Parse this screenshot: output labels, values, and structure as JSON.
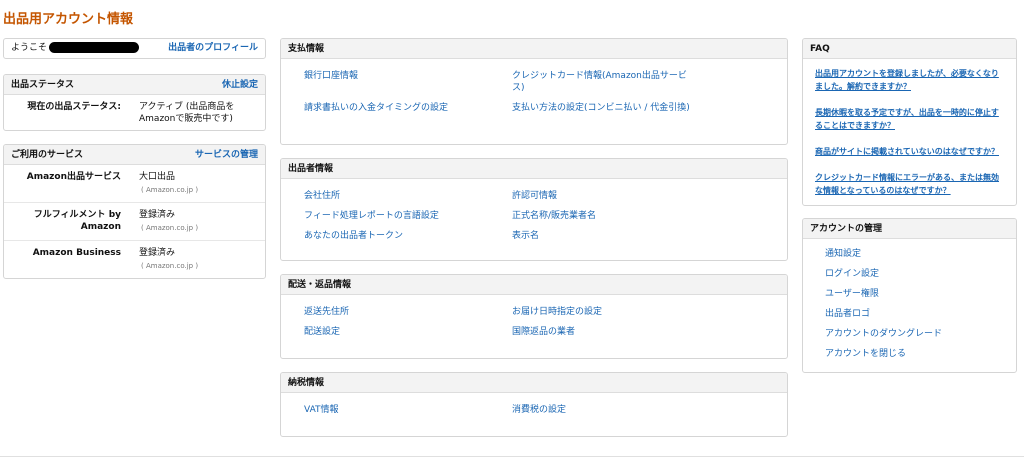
{
  "page_title": "出品用アカウント情報",
  "welcome": {
    "label": "ようこそ",
    "profile_link": "出品者のプロフィール"
  },
  "seller_status": {
    "title": "出品ステータス",
    "action": "休止設定",
    "rows": [
      {
        "key": "現在の出品ステータス:",
        "value": "アクティブ (出品商品をAmazonで販売中です)"
      }
    ]
  },
  "services": {
    "title": "ご利用のサービス",
    "action": "サービスの管理",
    "rows": [
      {
        "key": "Amazon出品サービス",
        "value": "大口出品",
        "sub": "( Amazon.co.jp )"
      },
      {
        "key": "フルフィルメント by Amazon",
        "value": "登録済み",
        "sub": "( Amazon.co.jp )"
      },
      {
        "key": "Amazon Business",
        "value": "登録済み",
        "sub": "( Amazon.co.jp )"
      }
    ]
  },
  "payment": {
    "title": "支払情報",
    "left": [
      "銀行口座情報",
      "請求書払いの入金タイミングの設定"
    ],
    "right": [
      "クレジットカード情報(Amazon出品サービス)",
      "支払い方法の設定(コンビニ払い / 代金引換)"
    ]
  },
  "seller_info": {
    "title": "出品者情報",
    "left": [
      "会社住所",
      "フィード処理レポートの言語設定",
      "あなたの出品者トークン"
    ],
    "right": [
      "許認可情報",
      "正式名称/販売業者名",
      "表示名"
    ]
  },
  "shipping": {
    "title": "配送・返品情報",
    "left": [
      "返送先住所",
      "配送設定"
    ],
    "right": [
      "お届け日時指定の設定",
      "国際返品の業者"
    ]
  },
  "tax": {
    "title": "納税情報",
    "left": [
      "VAT情報"
    ],
    "right": [
      "消費税の設定"
    ]
  },
  "faq": {
    "title": "FAQ",
    "items": [
      "出品用アカウントを登録しましたが、必要なくなりました。解約できますか？",
      "長期休暇を取る予定ですが、出品を一時的に停止することはできますか？",
      "商品がサイトに掲載されていないのはなぜですか？",
      "クレジットカード情報にエラーがある、または無効な情報となっているのはなぜですか？"
    ]
  },
  "account_mgmt": {
    "title": "アカウントの管理",
    "items": [
      "通知設定",
      "ログイン設定",
      "ユーザー権限",
      "出品者ロゴ",
      "アカウントのダウングレード",
      "アカウントを閉じる"
    ]
  }
}
